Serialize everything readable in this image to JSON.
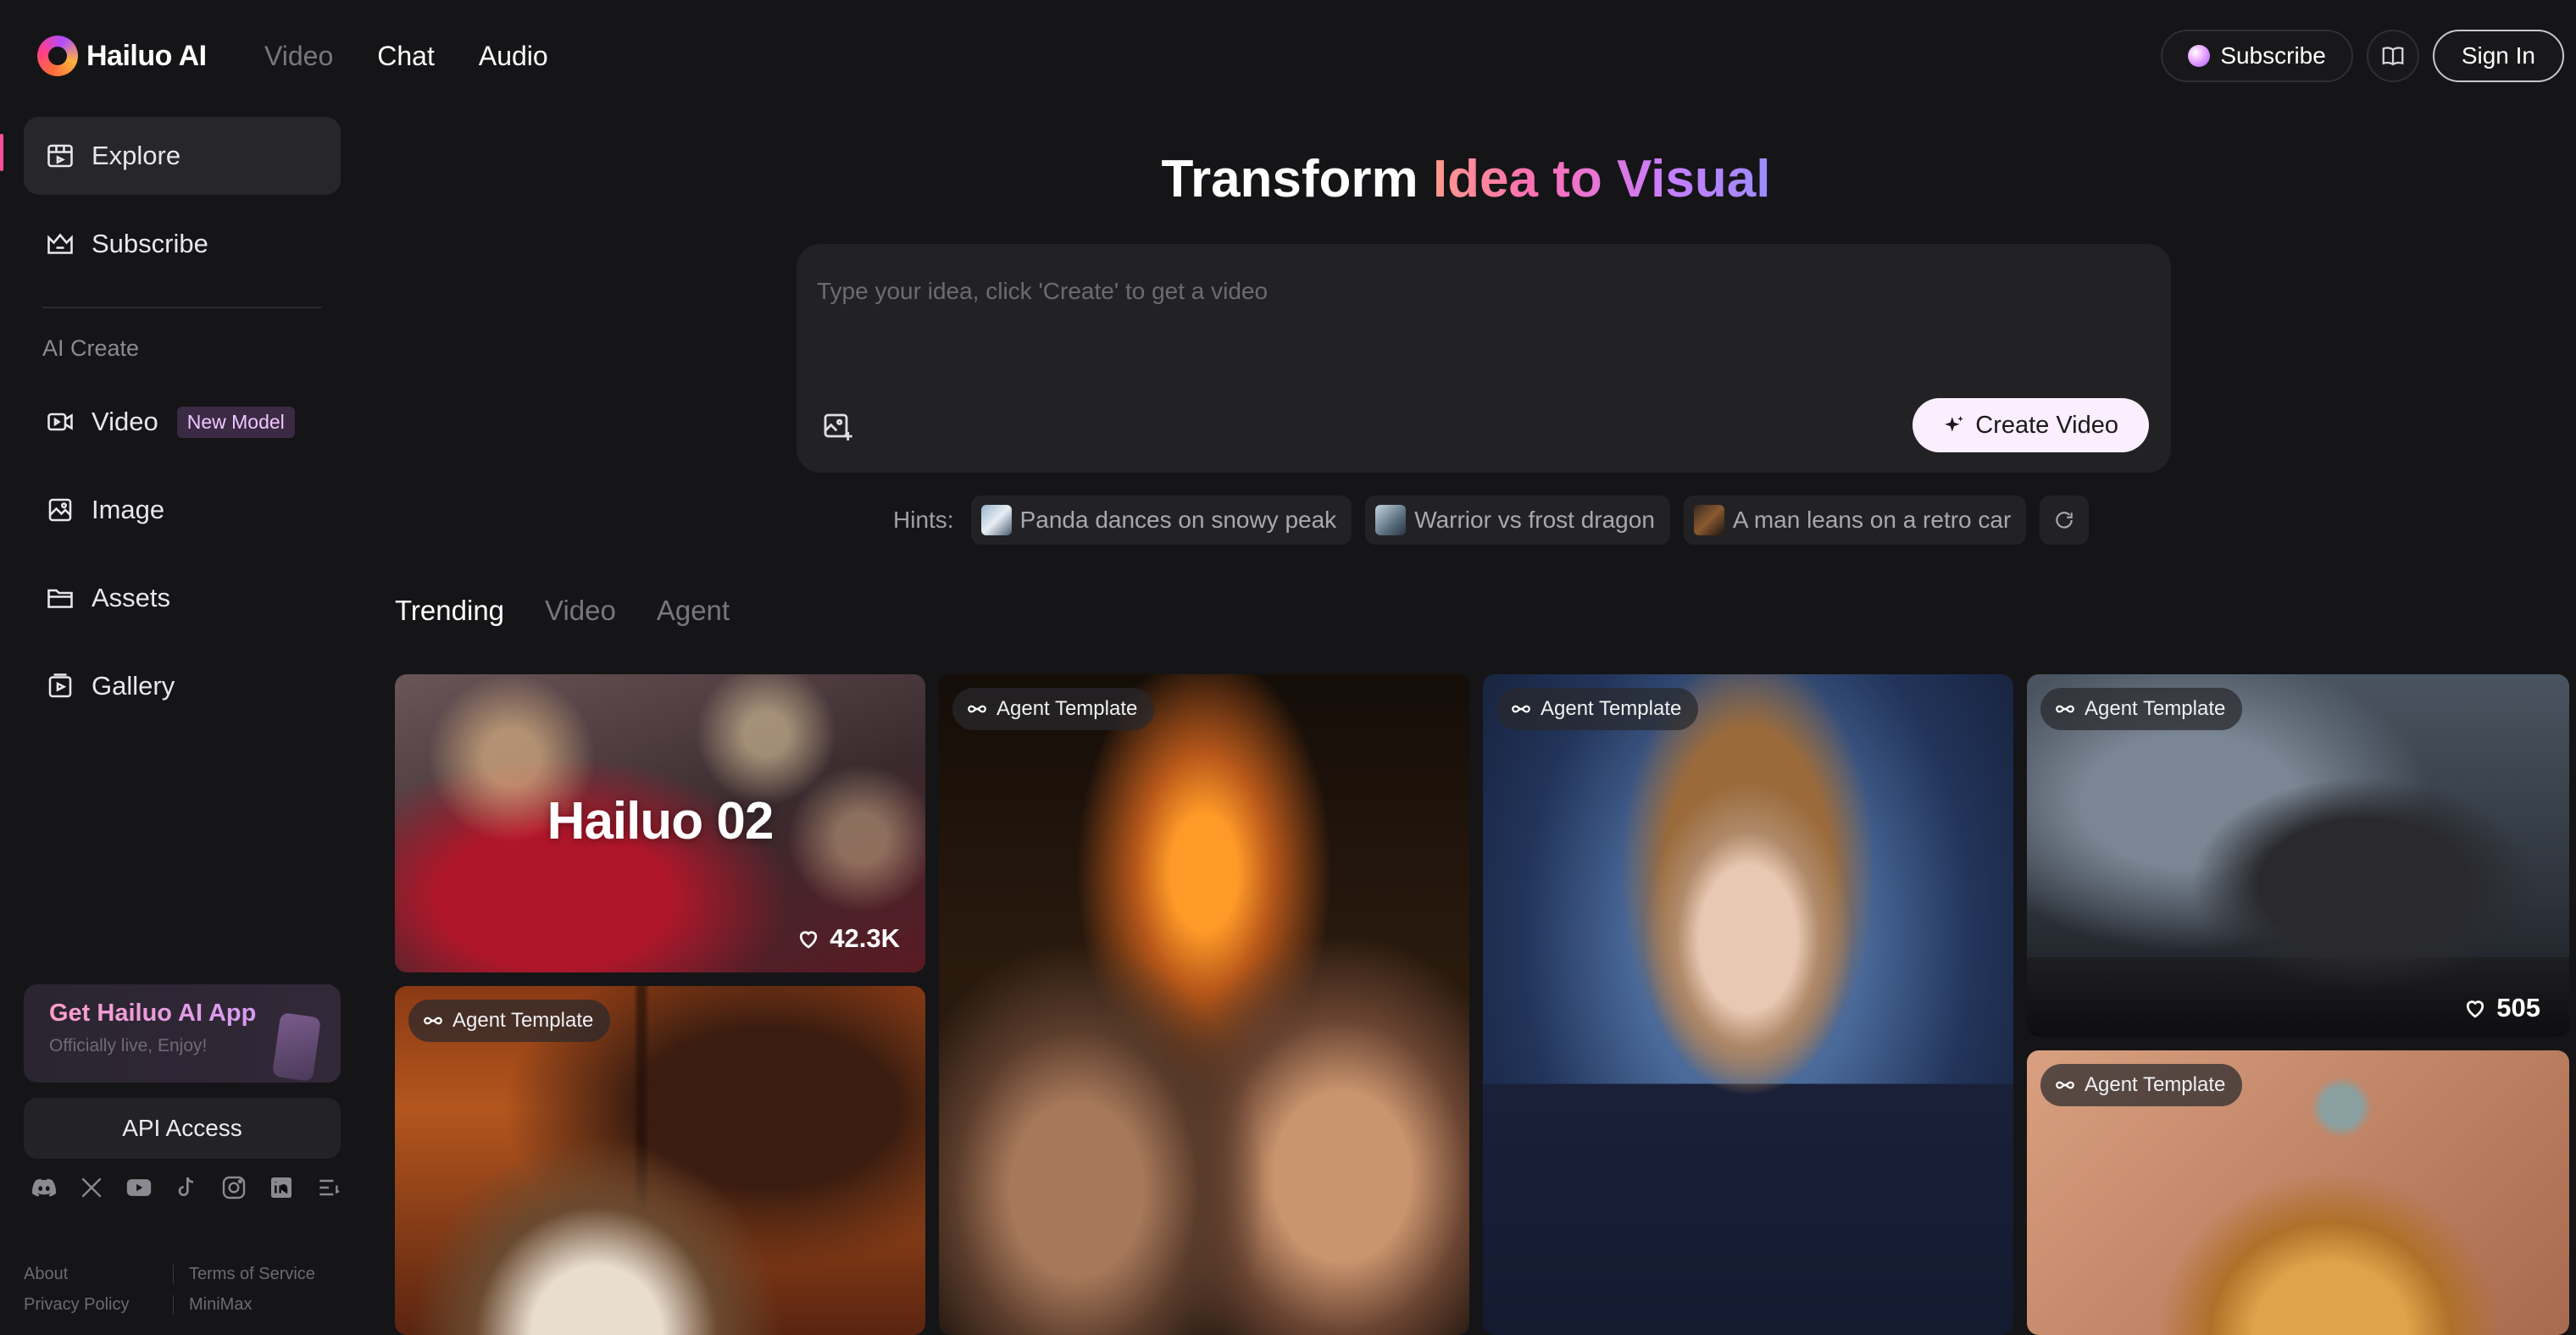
{
  "brand": {
    "name": "Hailuo AI"
  },
  "topnav": {
    "video": "Video",
    "chat": "Chat",
    "audio": "Audio"
  },
  "topright": {
    "subscribe": "Subscribe",
    "signin": "Sign In"
  },
  "sidebar": {
    "explore": "Explore",
    "subscribe": "Subscribe",
    "section": "AI Create",
    "video": "Video",
    "video_badge": "New Model",
    "image": "Image",
    "assets": "Assets",
    "gallery": "Gallery",
    "app_title": "Get Hailuo AI App",
    "app_sub": "Officially live, Enjoy!",
    "api": "API Access",
    "footer": {
      "about": "About",
      "terms": "Terms of Service",
      "privacy": "Privacy Policy",
      "company": "MiniMax"
    }
  },
  "hero": {
    "title_plain": "Transform ",
    "title_grad": "Idea to Visual",
    "placeholder": "Type your idea, click 'Create' to get a video",
    "create": "Create Video"
  },
  "hints": {
    "label": "Hints:",
    "items": [
      "Panda dances on snowy peak",
      "Warrior vs frost dragon",
      "A man leans on a retro car"
    ]
  },
  "tabs": [
    "Trending",
    "Video",
    "Agent"
  ],
  "gallery": {
    "agent_tag": "Agent Template",
    "card1_title": "Hailuo 02",
    "card1_likes": "42.3K",
    "card4_likes": "505"
  }
}
